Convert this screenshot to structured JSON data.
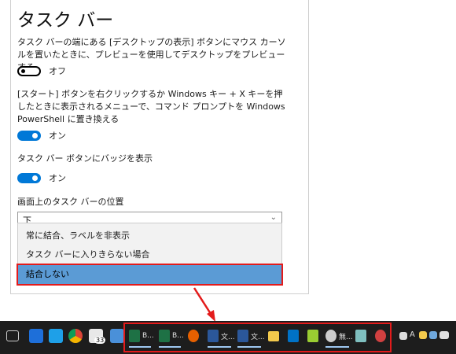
{
  "settings": {
    "title": "タスク バー",
    "peek": {
      "description": "タスク バーの端にある [デスクトップの表示] ボタンにマウス カーソルを置いたときに、プレビューを使用してデスクトップをプレビューする",
      "state_label": "オフ"
    },
    "powershell": {
      "description": "[スタート] ボタンを右クリックするか Windows キー + X キーを押したときに表示されるメニューで、コマンド プロンプトを Windows PowerShell に置き換える",
      "state_label": "オン"
    },
    "badges": {
      "description": "タスク バー ボタンにバッジを表示",
      "state_label": "オン"
    },
    "position": {
      "label": "画面上のタスク バーの位置",
      "value": "下"
    },
    "combine": {
      "options": [
        "常に結合、ラベルを非表示",
        "タスク バーに入りきらない場合",
        "結合しない"
      ],
      "selected_index": 2
    }
  },
  "taskbar": {
    "badge_count": "33",
    "apps": [
      {
        "icon": "excel-icon",
        "label": "B...",
        "color": "#1e7145"
      },
      {
        "icon": "excel-icon",
        "label": "B...",
        "color": "#1e7145"
      },
      {
        "icon": "firefox-icon",
        "label": "",
        "color": "#e66000"
      },
      {
        "icon": "word-icon",
        "label": "文...",
        "color": "#2b579a"
      },
      {
        "icon": "word-icon",
        "label": "文...",
        "color": "#2b579a"
      },
      {
        "icon": "folder-icon",
        "label": "",
        "color": "#f2c94c"
      },
      {
        "icon": "outlook-icon",
        "label": "",
        "color": "#0072c6"
      },
      {
        "icon": "plus-app-icon",
        "label": "",
        "color": "#9acd32"
      },
      {
        "icon": "paint-icon",
        "label": "無...",
        "color": "#cccccc"
      },
      {
        "icon": "notepad-icon",
        "label": "",
        "color": "#7fbfbf"
      },
      {
        "icon": "game-icon",
        "label": "",
        "color": "#d04040"
      }
    ],
    "tray_text": "A"
  },
  "colors": {
    "accent": "#0078d7",
    "highlight_border": "#e31b1b",
    "selected_item": "#5b9bd5",
    "taskbar": "#1d1d1d"
  }
}
